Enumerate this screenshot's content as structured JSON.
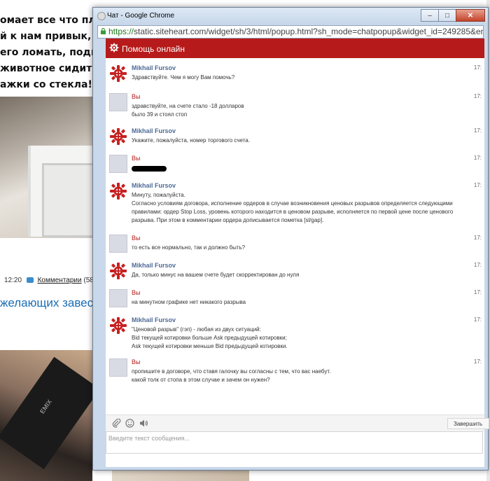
{
  "background_page": {
    "article_lines": [
      "омает все что пло",
      "й к нам привык, за",
      "его ломать, подка",
      "животное сидит м",
      "ажки со стекла!"
    ],
    "meta_time": "12:20",
    "comments_label": "Комментарии",
    "comments_count": "(58)",
    "heading_fragment": "желающих завес",
    "photo_label": "EMIX"
  },
  "window": {
    "title": "Чат - Google Chrome",
    "url_secure": "https://",
    "url_rest": "static.siteheart.com/widget/sh/3/html/popup.html?sh_mode=chatpopup&widget_id=249285&ent_id"
  },
  "chat": {
    "header_title": "Помощь онлайн",
    "accent_color": "#b71a1a",
    "messages": [
      {
        "author": "Mikhail Fursov",
        "role": "agent",
        "time": "17:",
        "lines": [
          "Здравствуйте. Чем я могу Вам помочь?"
        ]
      },
      {
        "author": "Вы",
        "role": "user",
        "time": "17:",
        "lines": [
          "здравствуйте, на счете стало -18 долларов",
          "было 39 и стоял стоп"
        ]
      },
      {
        "author": "Mikhail Fursov",
        "role": "agent",
        "time": "17:",
        "lines": [
          "Укажите, пожалуйста, номер торгового счета."
        ]
      },
      {
        "author": "Вы",
        "role": "user",
        "time": "17:",
        "lines": [],
        "redacted": true
      },
      {
        "author": "Mikhail Fursov",
        "role": "agent",
        "time": "17:",
        "lines": [
          "Минуту, пожалуйста.",
          "Согласно условиям договора, исполнение ордеров в случае возникновения ценовых разрывов определяется следующими правилами: ордер Stop Loss, уровень которого находится в ценовом разрыве, исполняется по первой цене после ценового разрыва. При этом в комментарии ордера дописывается пометка [sl/gap]."
        ]
      },
      {
        "author": "Вы",
        "role": "user",
        "time": "17:",
        "lines": [
          "то есть все нормально, так и должно быть?"
        ]
      },
      {
        "author": "Mikhail Fursov",
        "role": "agent",
        "time": "17:",
        "lines": [
          "Да, только минус на вашем счете будет скорректирован до нуля"
        ]
      },
      {
        "author": "Вы",
        "role": "user",
        "time": "17:",
        "lines": [
          "на минутном графике нет никакого разрыва"
        ]
      },
      {
        "author": "Mikhail Fursov",
        "role": "agent",
        "time": "17:",
        "lines": [
          "\"Ценовой разрыв\" (гэп) - любая из двух ситуаций:",
          "Bid текущей котировки больше Ask предыдущей котировки;",
          "Ask текущей котировки меньше Bid предыдущей котировки."
        ]
      },
      {
        "author": "Вы",
        "role": "user",
        "time": "17:",
        "lines": [
          "пропишите в договоре, что ставя галочку вы согласны с тем, что вас наебут.",
          "какой толк от стопа в этом случае и зачем он нужен?"
        ]
      }
    ],
    "end_button_label": "Завершить",
    "input_placeholder": "Введите текст сообщения..."
  }
}
